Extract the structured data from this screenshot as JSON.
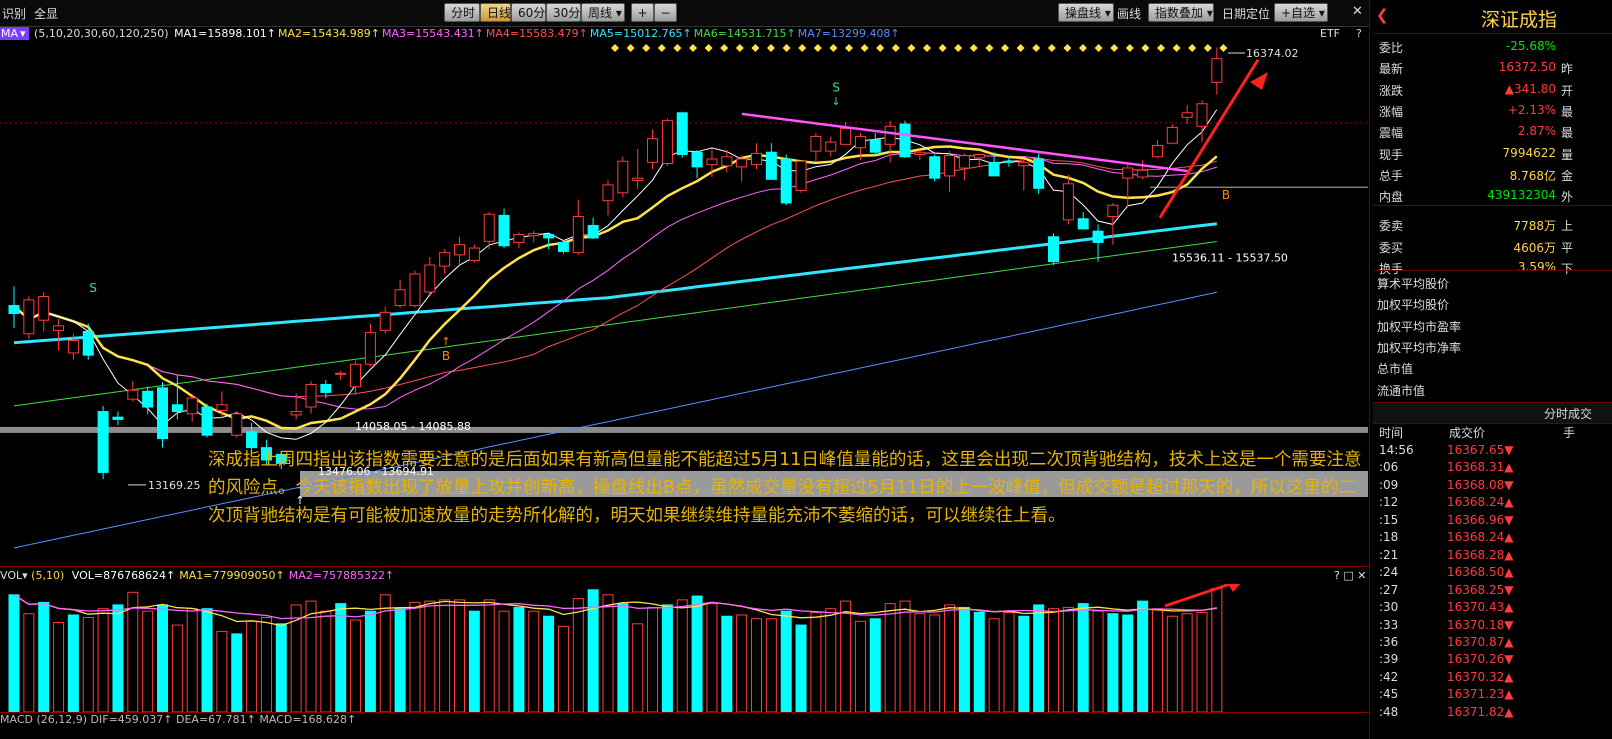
{
  "toolbar": {
    "left": [
      "识别",
      "全显"
    ],
    "periods": [
      "分时",
      "日线",
      "60分",
      "30分",
      "周线"
    ],
    "active_period": "日线",
    "zoom": [
      "+",
      "−"
    ],
    "right": [
      "操盘线",
      "画线",
      "指数叠加",
      "日期定位",
      "+自选"
    ],
    "close": "✕"
  },
  "ma_row": {
    "prefix": "MA",
    "params": "(5,10,20,30,60,120,250)",
    "items": [
      {
        "label": "MA1=15898.101↑",
        "color": "#ffffff"
      },
      {
        "label": "MA2=15434.989↑",
        "color": "#ffe14a"
      },
      {
        "label": "MA3=15543.431↑",
        "color": "#ff66ff"
      },
      {
        "label": "MA4=15583.479↑",
        "color": "#ff5050"
      },
      {
        "label": "MA5=15012.765↑",
        "color": "#2ee6ff"
      },
      {
        "label": "MA6=14531.715↑",
        "color": "#44dd44"
      },
      {
        "label": "MA7=13299.408↑",
        "color": "#5a8cff"
      }
    ],
    "etf": "ETF",
    "help": "?"
  },
  "chart_labels": {
    "peak": "16374.02",
    "low": "13169.25",
    "zone1": "14058.05 - 14085.88",
    "zone2": "13476.06 - 13694.91",
    "zone3": "15536.11 - 15537.50",
    "buy": "B",
    "sell": "S"
  },
  "annotation": "深成指上周四指出该指数需要注意的是后面如果有新高但量能不能超过5月11日峰值量能的话，这里会出现二次顶背驰结构，技术上这是一个需要注意的风险点。今天该指数出现了放量上攻并创新高，操盘线出B点，虽然成交量没有超过5月11日的上一波峰值，但成交额是超过那天的，所以这里的二次顶背驰结构是有可能被加速放量的走势所化解的，明天如果继续维持量能充沛不萎缩的话，可以继续往上看。",
  "vol_row": {
    "prefix": "VOL",
    "params": "(5,10)",
    "items": [
      {
        "label": "VOL=876768624↑",
        "color": "#ffffff"
      },
      {
        "label": "MA1=779909050↑",
        "color": "#ffe14a"
      },
      {
        "label": "MA2=757885322↑",
        "color": "#ff66ff"
      }
    ],
    "controls": "? □ ✕"
  },
  "macd_row": "MACD (26,12,9)  DIF=459.037↑  DEA=67.781↑  MACD=168.628↑",
  "panel": {
    "title": "深证成指",
    "quote": [
      {
        "k": "委比",
        "v": "-25.68%",
        "c": "green",
        "x": ""
      },
      {
        "k": "最新",
        "v": "16372.50",
        "c": "red",
        "x": "昨"
      },
      {
        "k": "涨跌",
        "v": "▲341.80",
        "c": "red",
        "x": "开"
      },
      {
        "k": "涨幅",
        "v": "+2.13%",
        "c": "red",
        "x": "最"
      },
      {
        "k": "震幅",
        "v": "2.87%",
        "c": "red",
        "x": "最"
      },
      {
        "k": "现手",
        "v": "7994622",
        "c": "yellow",
        "x": "量"
      },
      {
        "k": "总手",
        "v": "8.768亿",
        "c": "yellow",
        "x": "金"
      },
      {
        "k": "内盘",
        "v": "439132304",
        "c": "green",
        "x": "外"
      },
      {
        "k": "委卖",
        "v": "7788万",
        "c": "yellow",
        "x": "上"
      },
      {
        "k": "委买",
        "v": "4606万",
        "c": "yellow",
        "x": "平"
      },
      {
        "k": "换手",
        "v": "3.59%",
        "c": "yellow",
        "x": "下"
      }
    ],
    "metrics": [
      "算术平均股价",
      "加权平均股价",
      "加权平均市盈率",
      "加权平均市净率",
      "总市值",
      "流通市值"
    ],
    "trades_title": "分时成交",
    "trades_cols": [
      "时间",
      "成交价",
      "手"
    ],
    "trades": [
      {
        "t": "14:56",
        "p": "16367.65▼"
      },
      {
        "t": ":06",
        "p": "16368.31▲"
      },
      {
        "t": ":09",
        "p": "16368.08▼"
      },
      {
        "t": ":12",
        "p": "16368.24▲"
      },
      {
        "t": ":15",
        "p": "16366.96▼"
      },
      {
        "t": ":18",
        "p": "16368.24▲"
      },
      {
        "t": ":21",
        "p": "16368.28▲"
      },
      {
        "t": ":24",
        "p": "16368.50▲"
      },
      {
        "t": ":27",
        "p": "16368.25▼"
      },
      {
        "t": ":30",
        "p": "16370.43▲"
      },
      {
        "t": ":33",
        "p": "16370.18▼"
      },
      {
        "t": ":36",
        "p": "16370.87▲"
      },
      {
        "t": ":39",
        "p": "16370.26▼"
      },
      {
        "t": ":42",
        "p": "16370.32▲"
      },
      {
        "t": ":45",
        "p": "16371.23▲"
      },
      {
        "t": ":48",
        "p": "16371.82▲"
      }
    ]
  },
  "candles": [
    [
      15110,
      15180,
      15350,
      14980,
      "d"
    ],
    [
      15230,
      14930,
      15260,
      14880,
      "u"
    ],
    [
      15050,
      15260,
      15300,
      14950,
      "u"
    ],
    [
      15000,
      14960,
      15060,
      14780,
      "u"
    ],
    [
      14760,
      14870,
      14930,
      14700,
      "u"
    ],
    [
      14950,
      14740,
      15020,
      14700,
      "d"
    ],
    [
      14240,
      13700,
      14290,
      13640,
      "d"
    ],
    [
      14170,
      14190,
      14240,
      14120,
      "d"
    ],
    [
      14350,
      14430,
      14510,
      14330,
      "u"
    ],
    [
      14420,
      14280,
      14460,
      14220,
      "d"
    ],
    [
      14450,
      14000,
      14500,
      13920,
      "d"
    ],
    [
      14300,
      14240,
      14560,
      14170,
      "d"
    ],
    [
      14220,
      14360,
      14380,
      14150,
      "u"
    ],
    [
      14280,
      14030,
      14310,
      14010,
      "d"
    ],
    [
      14250,
      14300,
      14420,
      14180,
      "u"
    ],
    [
      14030,
      14220,
      14240,
      14010,
      "u"
    ],
    [
      14060,
      13920,
      14140,
      13890,
      "d"
    ],
    [
      13920,
      13810,
      13990,
      13760,
      "d"
    ],
    [
      13860,
      13780,
      13880,
      13730,
      "d"
    ],
    [
      14210,
      14240,
      14400,
      14170,
      "u"
    ],
    [
      14280,
      14480,
      14510,
      14220,
      "u"
    ],
    [
      14480,
      14410,
      14520,
      14360,
      "d"
    ],
    [
      14570,
      14580,
      14600,
      14520,
      "u"
    ],
    [
      14460,
      14660,
      14690,
      14390,
      "u"
    ],
    [
      14660,
      14940,
      15020,
      14640,
      "u"
    ],
    [
      14960,
      15120,
      15170,
      14930,
      "u"
    ],
    [
      15180,
      15320,
      15410,
      15160,
      "u"
    ],
    [
      15180,
      15460,
      15490,
      15160,
      "u"
    ],
    [
      15300,
      15540,
      15610,
      15280,
      "u"
    ],
    [
      15530,
      15650,
      15680,
      15460,
      "u"
    ],
    [
      15630,
      15720,
      15790,
      15540,
      "u"
    ],
    [
      15580,
      15690,
      15720,
      15560,
      "u"
    ],
    [
      15750,
      15990,
      16010,
      15680,
      "u"
    ],
    [
      15980,
      15710,
      16040,
      15690,
      "d"
    ],
    [
      15740,
      15810,
      15830,
      15690,
      "u"
    ],
    [
      15800,
      15820,
      15840,
      15740,
      "u"
    ],
    [
      15810,
      15780,
      15820,
      15680,
      "d"
    ],
    [
      15740,
      15660,
      15760,
      15640,
      "d"
    ],
    [
      15650,
      15970,
      16120,
      15630,
      "u"
    ],
    [
      15890,
      15780,
      15960,
      15770,
      "d"
    ],
    [
      16110,
      16250,
      16290,
      15980,
      "u"
    ],
    [
      16180,
      16460,
      16500,
      16140,
      "u"
    ],
    [
      16290,
      16310,
      16570,
      16210,
      "u"
    ],
    [
      16450,
      16660,
      16740,
      16390,
      "u"
    ],
    [
      16440,
      16820,
      16840,
      16420,
      "u"
    ],
    [
      16890,
      16520,
      16900,
      16490,
      "d"
    ],
    [
      16540,
      16410,
      16560,
      16310,
      "d"
    ],
    [
      16430,
      16480,
      16570,
      16320,
      "u"
    ],
    [
      16420,
      16500,
      16560,
      16360,
      "u"
    ],
    [
      16410,
      16480,
      16510,
      16280,
      "u"
    ],
    [
      16430,
      16530,
      16620,
      16390,
      "u"
    ],
    [
      16540,
      16300,
      16620,
      16310,
      "d"
    ],
    [
      16480,
      16090,
      16520,
      16070,
      "d"
    ],
    [
      16200,
      16460,
      16460,
      16180,
      "u"
    ],
    [
      16550,
      16680,
      16710,
      16460,
      "u"
    ],
    [
      16550,
      16630,
      16680,
      16500,
      "u"
    ],
    [
      16610,
      16750,
      16810,
      16610,
      "u"
    ],
    [
      16580,
      16680,
      16710,
      16470,
      "u"
    ],
    [
      16650,
      16540,
      16710,
      16520,
      "d"
    ],
    [
      16610,
      16770,
      16820,
      16450,
      "u"
    ],
    [
      16790,
      16500,
      16820,
      16490,
      "d"
    ],
    [
      16520,
      16540,
      16560,
      16470,
      "u"
    ],
    [
      16500,
      16310,
      16520,
      16280,
      "d"
    ],
    [
      16330,
      16510,
      16550,
      16190,
      "u"
    ],
    [
      16400,
      16510,
      16530,
      16290,
      "u"
    ],
    [
      16490,
      16520,
      16520,
      16420,
      "u"
    ],
    [
      16450,
      16330,
      16540,
      16330,
      "d"
    ],
    [
      16460,
      16450,
      16510,
      16410,
      "d"
    ],
    [
      16420,
      16450,
      16470,
      16200,
      "u"
    ],
    [
      16480,
      16220,
      16530,
      16170,
      "d"
    ],
    [
      15790,
      15570,
      15820,
      15540,
      "d"
    ],
    [
      15940,
      16260,
      16340,
      15900,
      "u"
    ],
    [
      15950,
      15860,
      16010,
      15860,
      "d"
    ],
    [
      15840,
      15740,
      15900,
      15570,
      "d"
    ],
    [
      15970,
      16070,
      16090,
      15720,
      "u"
    ],
    [
      16310,
      16400,
      16450,
      16050,
      "u"
    ],
    [
      16320,
      16380,
      16470,
      16300,
      "u"
    ],
    [
      16500,
      16600,
      16650,
      16490,
      "u"
    ],
    [
      16620,
      16760,
      16790,
      16610,
      "u"
    ],
    [
      16850,
      16890,
      16960,
      16790,
      "u"
    ],
    [
      16770,
      16970,
      17000,
      16630,
      "u"
    ],
    [
      17160,
      17370,
      17470,
      17050,
      "u"
    ]
  ],
  "volumes": [
    [
      0.93,
      "d"
    ],
    [
      0.78,
      "u"
    ],
    [
      0.87,
      "d"
    ],
    [
      0.71,
      "u"
    ],
    [
      0.77,
      "d"
    ],
    [
      0.75,
      "u"
    ],
    [
      0.82,
      "u"
    ],
    [
      0.85,
      "d"
    ],
    [
      0.95,
      "u"
    ],
    [
      0.8,
      "u"
    ],
    [
      0.85,
      "d"
    ],
    [
      0.69,
      "u"
    ],
    [
      0.82,
      "u"
    ],
    [
      0.82,
      "d"
    ],
    [
      0.64,
      "u"
    ],
    [
      0.62,
      "d"
    ],
    [
      0.72,
      "u"
    ],
    [
      0.75,
      "u"
    ],
    [
      0.7,
      "d"
    ],
    [
      0.85,
      "u"
    ],
    [
      0.88,
      "u"
    ],
    [
      0.8,
      "u"
    ],
    [
      0.86,
      "d"
    ],
    [
      0.73,
      "u"
    ],
    [
      0.8,
      "d"
    ],
    [
      0.93,
      "u"
    ],
    [
      0.82,
      "d"
    ],
    [
      0.87,
      "u"
    ],
    [
      0.88,
      "u"
    ],
    [
      0.89,
      "u"
    ],
    [
      0.89,
      "u"
    ],
    [
      0.8,
      "d"
    ],
    [
      0.89,
      "u"
    ],
    [
      0.8,
      "u"
    ],
    [
      0.83,
      "d"
    ],
    [
      0.8,
      "u"
    ],
    [
      0.76,
      "d"
    ],
    [
      0.68,
      "u"
    ],
    [
      0.9,
      "u"
    ],
    [
      0.97,
      "d"
    ],
    [
      0.93,
      "u"
    ],
    [
      0.86,
      "d"
    ],
    [
      0.7,
      "u"
    ],
    [
      0.83,
      "u"
    ],
    [
      0.85,
      "d"
    ],
    [
      0.89,
      "u"
    ],
    [
      0.92,
      "d"
    ],
    [
      0.86,
      "u"
    ],
    [
      0.76,
      "d"
    ],
    [
      0.77,
      "u"
    ],
    [
      0.74,
      "u"
    ],
    [
      0.74,
      "u"
    ],
    [
      0.8,
      "d"
    ],
    [
      0.69,
      "d"
    ],
    [
      0.79,
      "u"
    ],
    [
      0.82,
      "u"
    ],
    [
      0.88,
      "u"
    ],
    [
      0.72,
      "u"
    ],
    [
      0.74,
      "d"
    ],
    [
      0.86,
      "u"
    ],
    [
      0.88,
      "u"
    ],
    [
      0.78,
      "u"
    ],
    [
      0.77,
      "u"
    ],
    [
      0.85,
      "u"
    ],
    [
      0.83,
      "d"
    ],
    [
      0.79,
      "d"
    ],
    [
      0.74,
      "u"
    ],
    [
      0.79,
      "u"
    ],
    [
      0.76,
      "d"
    ],
    [
      0.85,
      "d"
    ],
    [
      0.82,
      "u"
    ],
    [
      0.83,
      "u"
    ],
    [
      0.86,
      "d"
    ],
    [
      0.8,
      "u"
    ],
    [
      0.78,
      "d"
    ],
    [
      0.77,
      "d"
    ],
    [
      0.88,
      "d"
    ],
    [
      0.82,
      "u"
    ],
    [
      0.76,
      "u"
    ],
    [
      0.78,
      "u"
    ],
    [
      0.79,
      "u"
    ],
    [
      0.98,
      "u"
    ]
  ]
}
